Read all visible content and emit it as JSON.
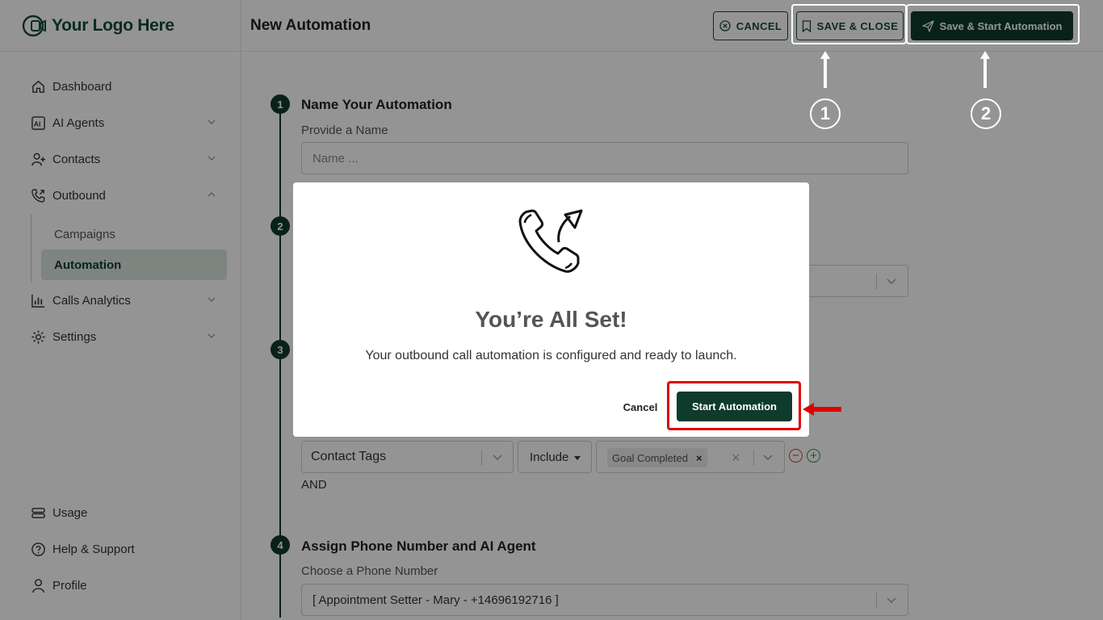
{
  "app": {
    "logo_text": "Your Logo Here",
    "page_title": "New Automation"
  },
  "sidebar": {
    "items": [
      {
        "label": "Dashboard",
        "icon": "home-icon"
      },
      {
        "label": "AI Agents",
        "icon": "ai-agent-icon"
      },
      {
        "label": "Contacts",
        "icon": "user-plus-icon"
      },
      {
        "label": "Outbound",
        "icon": "phone-outgoing-icon"
      },
      {
        "label": "Calls Analytics",
        "icon": "bar-chart-icon"
      },
      {
        "label": "Settings",
        "icon": "gear-icon"
      }
    ],
    "outbound_sub": [
      {
        "label": "Campaigns"
      },
      {
        "label": "Automation"
      }
    ],
    "bottom_items": [
      {
        "label": "Usage",
        "icon": "usage-icon"
      },
      {
        "label": "Help & Support",
        "icon": "help-icon"
      },
      {
        "label": "Profile",
        "icon": "profile-icon"
      }
    ]
  },
  "toolbar": {
    "cancel_label": "CANCEL",
    "save_close_label": "SAVE & CLOSE",
    "save_start_label": "Save & Start Automation"
  },
  "annotations": {
    "marker_1": "1",
    "marker_2": "2"
  },
  "steps": {
    "step1": {
      "number": "1",
      "title": "Name Your Automation",
      "field_label": "Provide a Name",
      "placeholder": "Name ..."
    },
    "step2": {
      "number": "2"
    },
    "step3": {
      "number": "3",
      "filter_field": "Contact Tags",
      "filter_operator": "Include",
      "filter_tag": "Goal Completed",
      "and_label": "AND"
    },
    "step4": {
      "number": "4",
      "title": "Assign Phone Number and AI Agent",
      "field_label": "Choose a Phone Number",
      "phone_value": "[ Appointment Setter - Mary - +14696192716 ]"
    }
  },
  "modal": {
    "icon": "phone-outgoing-icon",
    "title": "You’re All Set!",
    "message": "Your outbound call automation is configured and ready to launch.",
    "cancel_label": "Cancel",
    "start_label": "Start Automation"
  },
  "colors": {
    "brand": "#0e3b2c",
    "highlight": "#e00000"
  }
}
